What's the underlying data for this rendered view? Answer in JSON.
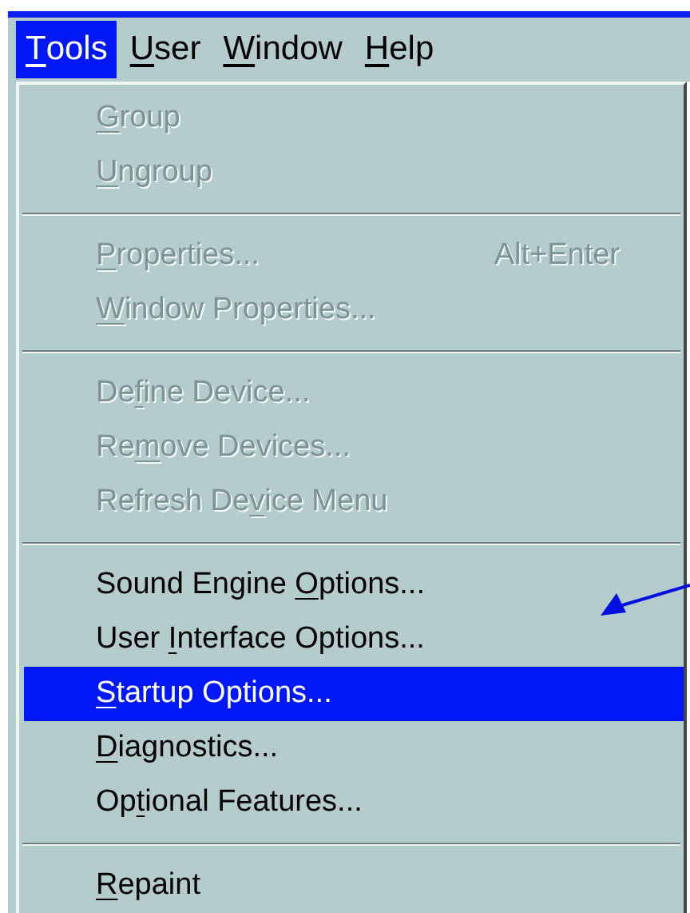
{
  "menu_bar": [
    {
      "label": {
        "key": "T",
        "post": "ools"
      },
      "selected": true
    },
    {
      "label": {
        "key": "U",
        "post": "ser"
      },
      "selected": false
    },
    {
      "label": {
        "key": "W",
        "post": "indow"
      },
      "selected": false
    },
    {
      "label": {
        "key": "H",
        "post": "elp"
      },
      "selected": false
    }
  ],
  "menu": {
    "groups": [
      [
        {
          "label": {
            "key": "G",
            "post": "roup"
          },
          "disabled": true,
          "selected": false
        },
        {
          "label": {
            "key": "U",
            "post": "ngroup"
          },
          "disabled": true,
          "selected": false
        }
      ],
      [
        {
          "label": {
            "key": "P",
            "post": "roperties..."
          },
          "shortcut": "Alt+Enter",
          "disabled": true,
          "selected": false
        },
        {
          "label": {
            "key": "W",
            "post": "indow Properties..."
          },
          "disabled": true,
          "selected": false
        }
      ],
      [
        {
          "label": {
            "pre": "De",
            "key": "f",
            "post": "ine Device..."
          },
          "disabled": true,
          "selected": false
        },
        {
          "label": {
            "pre": "Re",
            "key": "m",
            "post": "ove Devices..."
          },
          "disabled": true,
          "selected": false
        },
        {
          "label": {
            "pre": "Refresh De",
            "key": "v",
            "post": "ice Menu"
          },
          "disabled": true,
          "selected": false
        }
      ],
      [
        {
          "label": {
            "pre": "Sound Engine ",
            "key": "O",
            "post": "ptions..."
          },
          "disabled": false,
          "selected": false
        },
        {
          "label": {
            "pre": "User ",
            "key": "I",
            "post": "nterface Options..."
          },
          "disabled": false,
          "selected": false
        },
        {
          "label": {
            "key": "S",
            "post": "tartup Options..."
          },
          "disabled": false,
          "selected": true
        },
        {
          "label": {
            "key": "D",
            "post": "iagnostics..."
          },
          "disabled": false,
          "selected": false
        },
        {
          "label": {
            "pre": "Op",
            "key": "t",
            "post": "ional Features..."
          },
          "disabled": false,
          "selected": false
        }
      ],
      [
        {
          "label": {
            "key": "R",
            "post": "epaint"
          },
          "disabled": false,
          "selected": false
        }
      ]
    ]
  }
}
